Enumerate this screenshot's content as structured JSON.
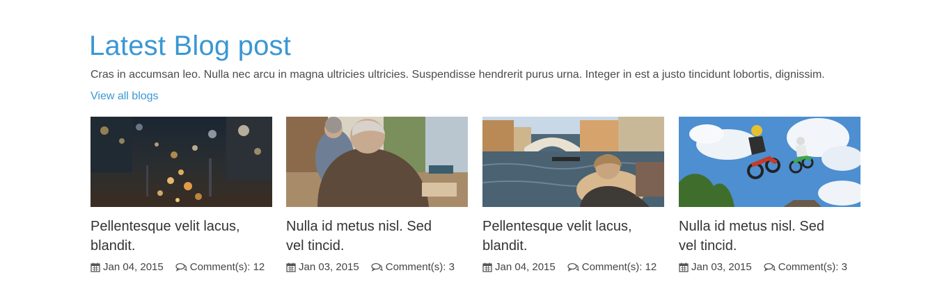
{
  "section": {
    "title": "Latest Blog post",
    "description": "Cras in accumsan leo. Nulla nec arcu in magna ultricies ultricies. Suspendisse hendrerit purus urna. Integer in est a justo tincidunt lobortis, dignissim.",
    "view_all_label": "View all blogs"
  },
  "posts": [
    {
      "title": "Pellentesque velit lacus, blandit.",
      "date": "Jan 04, 2015",
      "comments": "Comment(s): 12",
      "image": "city-night-traffic-photo"
    },
    {
      "title": "Nulla id metus nisl. Sed vel tincid.",
      "date": "Jan 03, 2015",
      "comments": "Comment(s): 3",
      "image": "cafe-men-sitting-photo"
    },
    {
      "title": "Pellentesque velit lacus, blandit.",
      "date": "Jan 04, 2015",
      "comments": "Comment(s): 12",
      "image": "venice-canal-photo"
    },
    {
      "title": "Nulla id metus nisl. Sed vel tincid.",
      "date": "Jan 03, 2015",
      "comments": "Comment(s): 3",
      "image": "motocross-jump-photo"
    }
  ],
  "icons": {
    "date": "calendar-icon",
    "comments": "comments-icon"
  },
  "colors": {
    "accent": "#3a97d4",
    "text": "#333333"
  }
}
